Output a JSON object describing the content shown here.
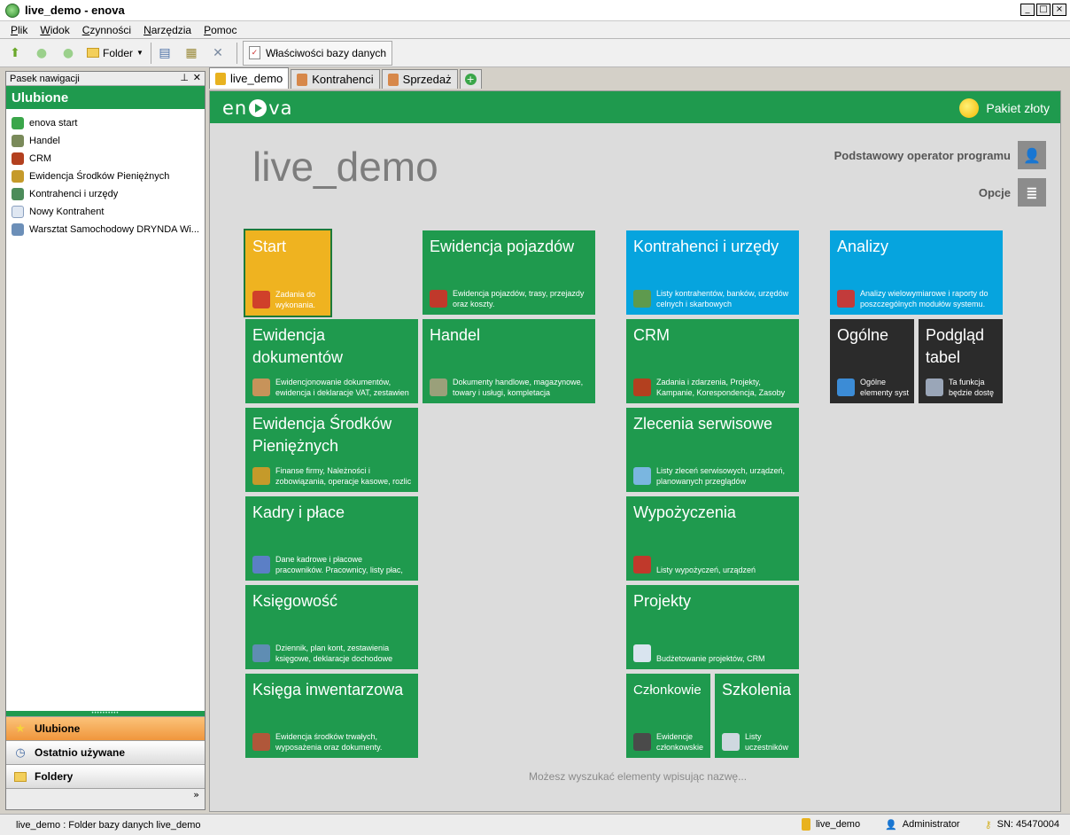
{
  "window": {
    "title": "live_demo - enova"
  },
  "menu": [
    "Plik",
    "Widok",
    "Czynności",
    "Narzędzia",
    "Pomoc"
  ],
  "toolbar": {
    "folder_label": "Folder",
    "db_props_label": "Właściwości bazy danych"
  },
  "nav": {
    "header": "Pasek nawigacji",
    "section_title": "Ulubione",
    "favorites": [
      {
        "label": "enova start",
        "icon": "enova-icon",
        "color": "#3aa64a"
      },
      {
        "label": "Handel",
        "icon": "handel-icon",
        "color": "#7a8a5a"
      },
      {
        "label": "CRM",
        "icon": "phone-icon",
        "color": "#b3401f"
      },
      {
        "label": "Ewidencja Środków Pieniężnych",
        "icon": "coins-icon",
        "color": "#c59a2a"
      },
      {
        "label": "Kontrahenci i urzędy",
        "icon": "contacts-icon",
        "color": "#4c8c5a"
      },
      {
        "label": "Nowy Kontrahent",
        "icon": "document-icon",
        "color": "#dfe7f2"
      },
      {
        "label": "Warsztat Samochodowy DRYNDA Wi...",
        "icon": "form-icon",
        "color": "#6c8fb8"
      }
    ],
    "bottom_buttons": [
      {
        "label": "Ulubione",
        "icon": "star-icon",
        "active": true
      },
      {
        "label": "Ostatnio używane",
        "icon": "clock-icon",
        "active": false
      },
      {
        "label": "Foldery",
        "icon": "folder-icon",
        "active": false
      }
    ]
  },
  "tabs": [
    {
      "label": "live_demo",
      "active": true,
      "color": "#e8b21f"
    },
    {
      "label": "Kontrahenci",
      "active": false,
      "color": "#d7884a"
    },
    {
      "label": "Sprzedaż",
      "active": false,
      "color": "#d7884a"
    }
  ],
  "main": {
    "brand": "enova",
    "package": "Pakiet złoty",
    "db_title": "live_demo",
    "operator": "Podstawowy operator programu",
    "options": "Opcje",
    "search_hint": "Możesz wyszukać elementy wpisując nazwę..."
  },
  "tiles": [
    {
      "id": "start",
      "title": "Start",
      "desc": "Zadania do\nwykonania.",
      "color": "y",
      "icon_color": "#d0402a"
    },
    {
      "id": "ewidencja-pojazdow",
      "title": "Ewidencja pojazdów",
      "desc": "Ewidencja pojazdów, trasy, przejazdy\noraz koszty.",
      "color": "g",
      "icon_color": "#c0392b"
    },
    {
      "id": "kontrahenci",
      "title": "Kontrahenci i urzędy",
      "desc": "Listy kontrahentów, banków, urzędów\ncelnych i skarbowych",
      "color": "b",
      "icon_color": "#5e9a4e"
    },
    {
      "id": "analizy",
      "title": "Analizy",
      "desc": "Analizy wielowymiarowe i raporty do\nposzczególnych modułów systemu.",
      "color": "b",
      "icon_color": "#c23b3b"
    },
    {
      "id": "ewidencja-dokumentow",
      "title": "Ewidencja\ndokumentów",
      "desc": "Ewidencjonowanie dokumentów,\newidencja i deklaracje VAT, zestawien",
      "color": "g",
      "icon_color": "#c7935a"
    },
    {
      "id": "handel",
      "title": "Handel",
      "desc": "Dokumenty handlowe, magazynowe,\ntowary i usługi, kompletacja",
      "color": "g",
      "icon_color": "#9aa07a"
    },
    {
      "id": "crm",
      "title": "CRM",
      "desc": "Zadania i zdarzenia, Projekty,\nKampanie, Korespondencja, Zasoby",
      "color": "g",
      "icon_color": "#b3401f"
    },
    {
      "id": "ogolne",
      "title": "Ogólne",
      "desc": "Ogólne\nelementy syst",
      "color": "k",
      "icon_color": "#3c8cd6"
    },
    {
      "id": "podglad-tabel",
      "title": "Podgląd\ntabel",
      "desc": "Ta funkcja\nbędzie dostę",
      "color": "k",
      "icon_color": "#9aa6b8"
    },
    {
      "id": "ewidencja-srodkow",
      "title": "Ewidencja Środków\nPieniężnych",
      "desc": "Finanse firmy, Należności i\nzobowiązania, operacje kasowe, rozlic",
      "color": "g",
      "icon_color": "#c59a2a"
    },
    {
      "id": "zlecenia-serwisowe",
      "title": "Zlecenia serwisowe",
      "desc": "Listy zleceń serwisowych, urządzeń,\nplanowanych przeglądów",
      "color": "g",
      "icon_color": "#7ab6e0"
    },
    {
      "id": "kadry",
      "title": "Kadry i płace",
      "desc": "Dane kadrowe i płacowe\npracowników. Pracownicy, listy płac,",
      "color": "g",
      "icon_color": "#5b7fc6"
    },
    {
      "id": "wypozyczenia",
      "title": "Wypożyczenia",
      "desc": "Listy wypożyczeń, urządzeń",
      "color": "g",
      "icon_color": "#c0392b"
    },
    {
      "id": "ksiegowosc",
      "title": "Księgowość",
      "desc": "Dziennik, plan kont, zestawienia\nksięgowe, deklaracje dochodowe",
      "color": "g",
      "icon_color": "#5f8db3"
    },
    {
      "id": "projekty",
      "title": "Projekty",
      "desc": "Budżetowanie projektów, CRM",
      "color": "g",
      "icon_color": "#d9e4ef"
    },
    {
      "id": "ksiega-inwentarzowa",
      "title": "Księga inwentarzowa",
      "desc": "Ewidencja środków trwałych,\nwyposażenia oraz dokumenty.",
      "color": "g",
      "icon_color": "#b0573a"
    },
    {
      "id": "czlonkowie",
      "title": "Członkowie",
      "desc": "Ewidencje\nczłonkowskie",
      "color": "g",
      "icon_color": "#4a4a4a"
    },
    {
      "id": "szkolenia",
      "title": "Szkolenia",
      "desc": "Listy\nuczestników",
      "color": "g",
      "icon_color": "#cfd8e0"
    }
  ],
  "status": {
    "left": "live_demo : Folder bazy danych live_demo",
    "db": "live_demo",
    "user": "Administrator",
    "sn": "SN: 45470004"
  }
}
